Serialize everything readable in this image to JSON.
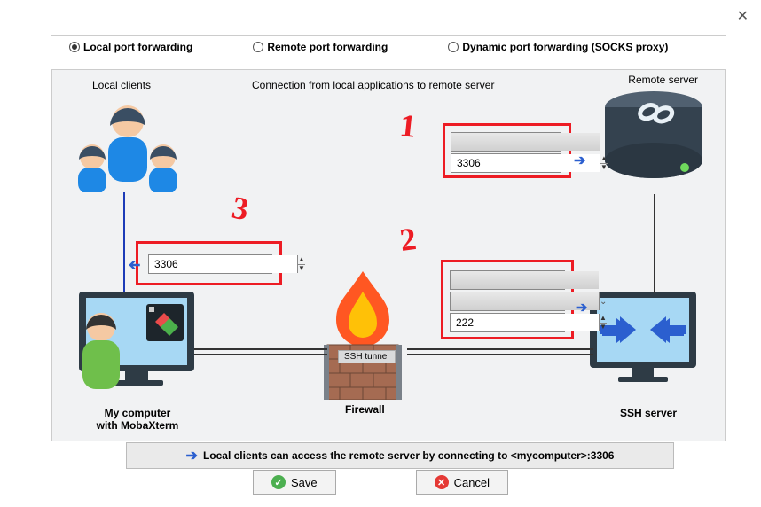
{
  "tabs": {
    "local": "Local port forwarding",
    "remote": "Remote port forwarding",
    "dynamic": "Dynamic port forwarding (SOCKS proxy)"
  },
  "headers": {
    "local_clients": "Local clients",
    "connection": "Connection from local applications to remote server",
    "remote_server": "Remote server"
  },
  "box1": {
    "host": "",
    "port": "3306"
  },
  "box2": {
    "host": "",
    "user": "",
    "port": "222"
  },
  "box3": {
    "port": "3306"
  },
  "markers": {
    "m1": "1",
    "m2": "2",
    "m3": "3"
  },
  "labels": {
    "ssh_tunnel": "SSH tunnel",
    "firewall": "Firewall",
    "ssh_server": "SSH server",
    "my_computer_l1": "My computer",
    "my_computer_l2": "with MobaXterm"
  },
  "hint": {
    "text": "Local clients can access the remote server by connecting to <mycomputer>:3306"
  },
  "buttons": {
    "save": "Save",
    "cancel": "Cancel"
  }
}
